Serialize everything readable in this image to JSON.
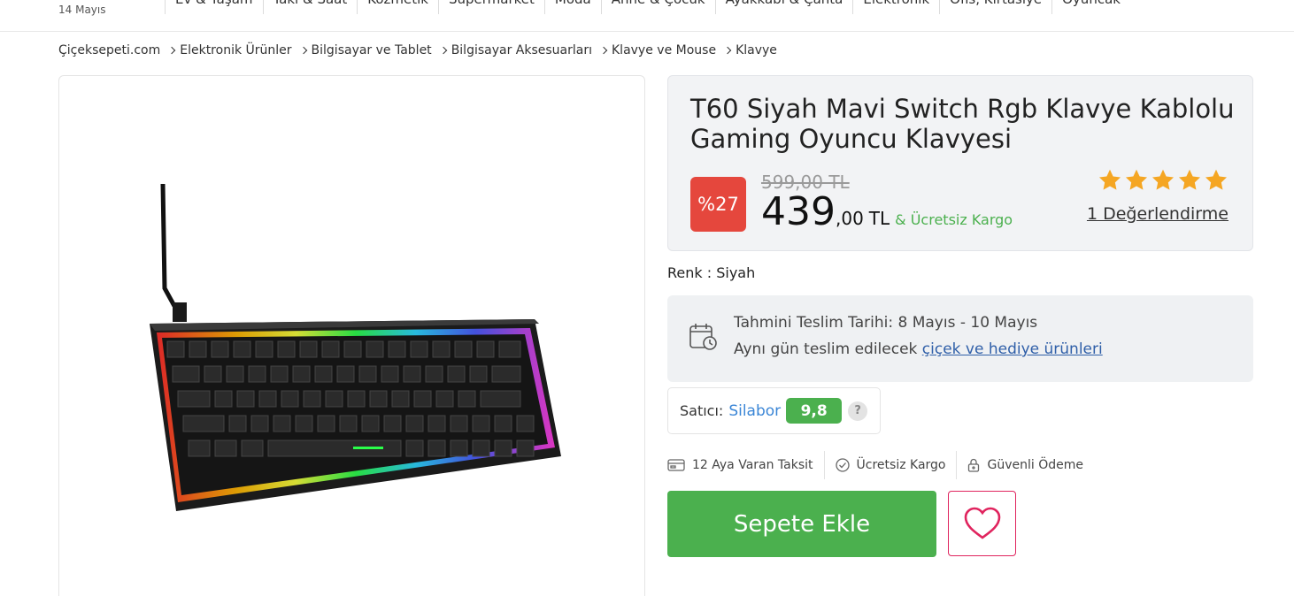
{
  "header": {
    "date": "14 Mayıs",
    "categories": [
      "Ev & Yaşam",
      "Takı & Saat",
      "Kozmetik",
      "Supermarket",
      "Moda",
      "Anne & Çocuk",
      "Ayakkabı & Çanta",
      "Elektronik",
      "Ofis, Kırtasiye",
      "Oyuncak"
    ]
  },
  "breadcrumb": [
    "Çiçeksepeti.com",
    "Elektronik Ürünler",
    "Bilgisayar ve Tablet",
    "Bilgisayar Aksesuarları",
    "Klavye ve Mouse",
    "Klavye"
  ],
  "product": {
    "title": "T60 Siyah Mavi Switch Rgb Klavye Kablolu Gaming Oyuncu Klavyesi",
    "discount": "%27",
    "old_price": "599,00 TL",
    "price_int": "439",
    "price_dec": ",00",
    "currency": "TL",
    "free_shipping": "& Ücretsiz Kargo",
    "rating_stars": 5,
    "review_count": "1 Değerlendirme",
    "color_label": "Renk : Siyah"
  },
  "delivery": {
    "line1": "Tahmini Teslim Tarihi: 8 Mayıs - 10 Mayıs",
    "line2_prefix": "Aynı gün teslim edilecek",
    "line2_link": "çiçek ve hediye ürünleri"
  },
  "seller": {
    "label": "Satıcı:",
    "name": "Silabor",
    "score": "9,8",
    "help": "?"
  },
  "features": [
    {
      "label": "12 Aya Varan Taksit",
      "icon": "card-icon"
    },
    {
      "label": "Ücretsiz Kargo",
      "icon": "check-circle-icon"
    },
    {
      "label": "Güvenli Ödeme",
      "icon": "lock-icon"
    }
  ],
  "actions": {
    "add_to_cart": "Sepete Ekle"
  },
  "colors": {
    "green": "#4bb04e",
    "discount_red": "#e5473d",
    "star": "#f5a623",
    "favorite": "#e0245e",
    "link_blue": "#3b86d6"
  }
}
